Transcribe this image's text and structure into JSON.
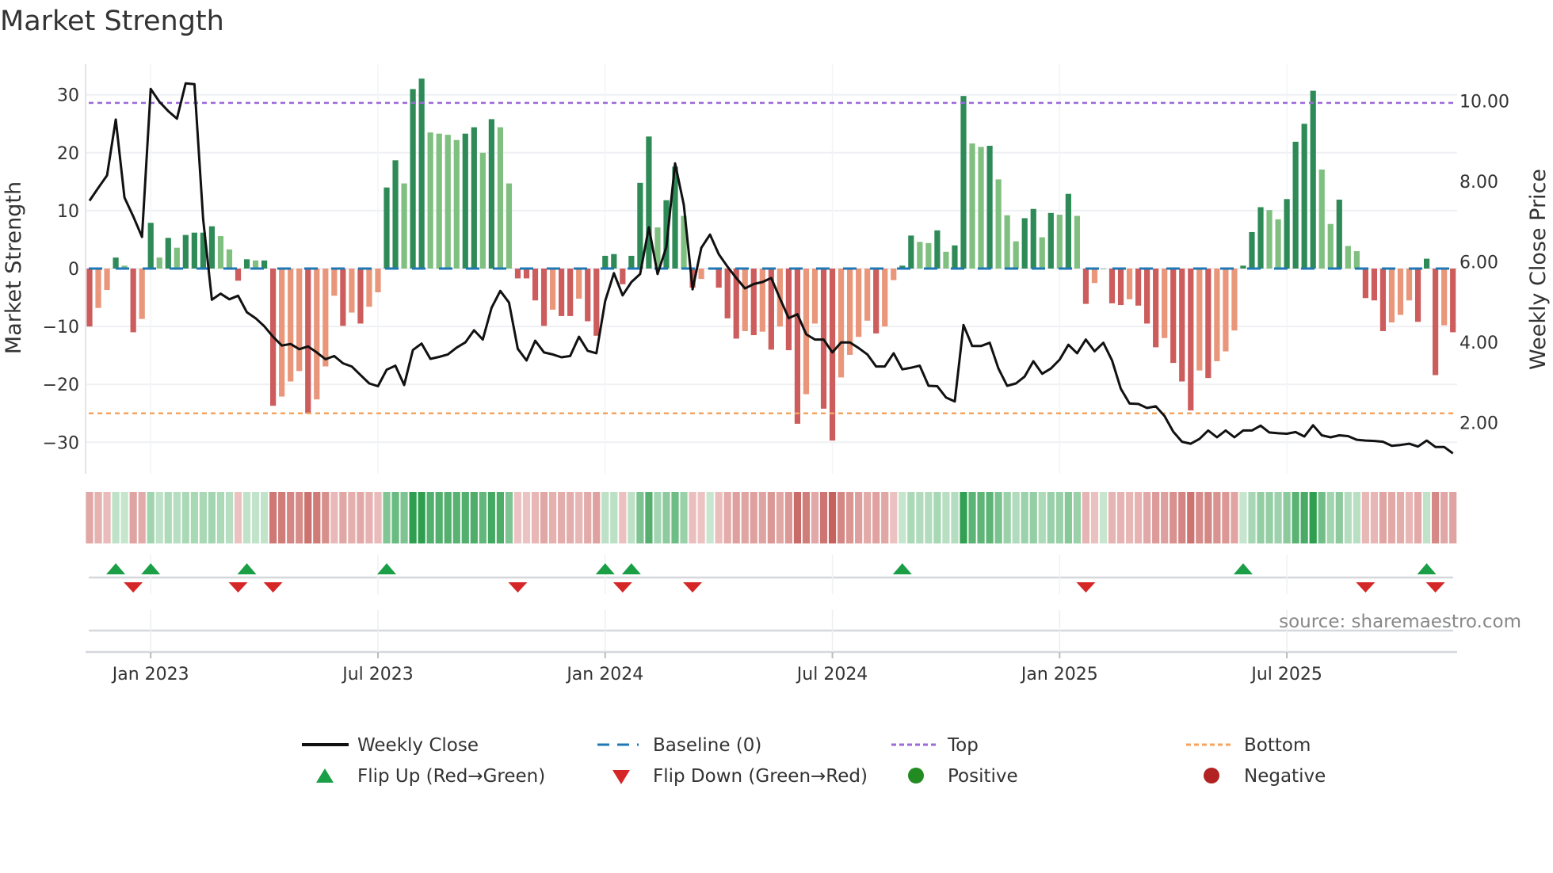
{
  "chart_data": {
    "type": "bar",
    "title": "Market Strength",
    "ylabel": "Market Strength",
    "y2label": "Weekly Close Price",
    "ylim": [
      -35.4,
      35.2
    ],
    "y2lim": [
      0.76,
      10.9
    ],
    "yticks": [
      "30",
      "20",
      "10",
      "0",
      "−10",
      "−20",
      "−30"
    ],
    "ytick_values": [
      30,
      20,
      10,
      0,
      -10,
      -20,
      -30
    ],
    "y2ticks": [
      "10.00",
      "8.00",
      "6.00",
      "4.00",
      "2.00"
    ],
    "y2tick_values": [
      10,
      8,
      6,
      4,
      2
    ],
    "xticks": [
      "Jan 2023",
      "Jul 2023",
      "Jan 2024",
      "Jul 2024",
      "Jan 2025",
      "Jul 2025"
    ],
    "xtick_week_index": [
      7,
      33,
      59,
      85,
      111,
      137
    ],
    "x_unit": "week",
    "top_threshold": 28.6,
    "bottom_threshold": -25,
    "baseline": 0,
    "grid": true,
    "legend_position": "bottom",
    "strength": [
      -10,
      -6.8,
      -3.7,
      1.9,
      0.5,
      -11,
      -8.7,
      7.9,
      1.9,
      5.3,
      3.6,
      5.8,
      6.2,
      6.2,
      7.3,
      5.6,
      3.3,
      -2.1,
      1.6,
      1.4,
      1.4,
      -23.7,
      -22.1,
      -19.5,
      -17.7,
      -25,
      -22.6,
      -16.9,
      -4.7,
      -9.9,
      -7.6,
      -9.5,
      -6.6,
      -4.1,
      14,
      18.7,
      14.7,
      31,
      32.8,
      23.5,
      23.3,
      23.1,
      22.2,
      23.3,
      24.4,
      20,
      25.8,
      24.4,
      14.7,
      -1.7,
      -1.7,
      -5.5,
      -9.9,
      -7.1,
      -8.2,
      -8.2,
      -5.2,
      -9.1,
      -11.6,
      2.2,
      2.5,
      -2.7,
      2.2,
      14.8,
      22.8,
      7.1,
      11.8,
      17.6,
      9.1,
      -3.3,
      -1.8,
      0,
      -3.3,
      -8.6,
      -12.1,
      -10.8,
      -11.5,
      -10.9,
      -14,
      -10,
      -14.1,
      -26.8,
      -21.7,
      -9.5,
      -24.2,
      -29.7,
      -18.8,
      -14.9,
      -11.8,
      -9,
      -11.2,
      -10,
      -2,
      0.5,
      5.7,
      4.6,
      4.4,
      6.6,
      2.9,
      4.0,
      29.8,
      21.6,
      21,
      21.2,
      15.4,
      9.2,
      4.7,
      8.7,
      10.3,
      5.4,
      9.6,
      9.3,
      12.9,
      9.1,
      -6.1,
      -2.5,
      0,
      -6,
      -6.3,
      -5.3,
      -6.4,
      -9.5,
      -13.6,
      -12,
      -16.3,
      -19.5,
      -24.5,
      -17.6,
      -18.9,
      -16,
      -14.3,
      -10.7,
      0.5,
      6.3,
      10.6,
      10.1,
      8.5,
      12,
      21.9,
      25,
      30.7,
      17.1,
      7.7,
      11.9,
      3.9,
      3,
      -5.1,
      -5.5,
      -10.8,
      -9.3,
      -8,
      -5.5,
      -9.2,
      1.7,
      -18.4,
      -9.8,
      -11
    ],
    "weekly_close": [
      7.52,
      7.84,
      8.15,
      9.54,
      7.6,
      7.13,
      6.62,
      10.3,
      9.98,
      9.75,
      9.56,
      10.44,
      10.42,
      7.06,
      5.06,
      5.21,
      5.07,
      5.16,
      4.75,
      4.6,
      4.4,
      4.14,
      3.92,
      3.96,
      3.83,
      3.9,
      3.75,
      3.58,
      3.66,
      3.48,
      3.4,
      3.19,
      2.98,
      2.91,
      3.32,
      3.42,
      2.94,
      3.81,
      3.97,
      3.59,
      3.64,
      3.7,
      3.87,
      4.0,
      4.3,
      4.07,
      4.86,
      5.28,
      4.99,
      3.84,
      3.55,
      4.04,
      3.75,
      3.7,
      3.63,
      3.66,
      4.14,
      3.79,
      3.73,
      5.03,
      5.72,
      5.17,
      5.5,
      5.7,
      6.86,
      5.7,
      6.37,
      8.45,
      7.42,
      5.32,
      6.35,
      6.68,
      6.19,
      5.88,
      5.6,
      5.34,
      5.45,
      5.5,
      5.6,
      5.09,
      4.6,
      4.7,
      4.2,
      4.07,
      4.07,
      3.75,
      4.0,
      4.0,
      3.86,
      3.7,
      3.4,
      3.4,
      3.73,
      3.33,
      3.37,
      3.42,
      2.92,
      2.91,
      2.63,
      2.53,
      4.43,
      3.91,
      3.91,
      3.99,
      3.35,
      2.92,
      2.98,
      3.15,
      3.53,
      3.22,
      3.35,
      3.57,
      3.94,
      3.73,
      4.07,
      3.78,
      3.99,
      3.55,
      2.85,
      2.48,
      2.47,
      2.37,
      2.41,
      2.17,
      1.78,
      1.53,
      1.48,
      1.6,
      1.81,
      1.64,
      1.81,
      1.64,
      1.81,
      1.81,
      1.93,
      1.76,
      1.74,
      1.73,
      1.77,
      1.66,
      1.94,
      1.69,
      1.64,
      1.69,
      1.67,
      1.58,
      1.56,
      1.55,
      1.53,
      1.43,
      1.45,
      1.48,
      1.41,
      1.56,
      1.4,
      1.4,
      1.24
    ],
    "legend": {
      "weekly_close": "Weekly Close",
      "baseline": "Baseline (0)",
      "top": "Top",
      "bottom": "Bottom",
      "flip_up": "Flip Up (Red→Green)",
      "flip_down": "Flip Down (Green→Red)",
      "positive": "Positive",
      "negative": "Negative"
    },
    "source": "source: sharemaestro.com"
  },
  "colors": {
    "pos_strong": "#2e8b57",
    "pos_weak": "#7fbf7f",
    "neg_strong": "#cd5c5c",
    "neg_weak": "#e9967a",
    "top": "#9b6ad8",
    "bottom": "#f4a460",
    "baseline": "#1f77b4",
    "line": "#111111",
    "flip_up": "#1a9e46",
    "flip_down": "#d62728",
    "positive": "#228b22",
    "negative": "#b22222"
  }
}
